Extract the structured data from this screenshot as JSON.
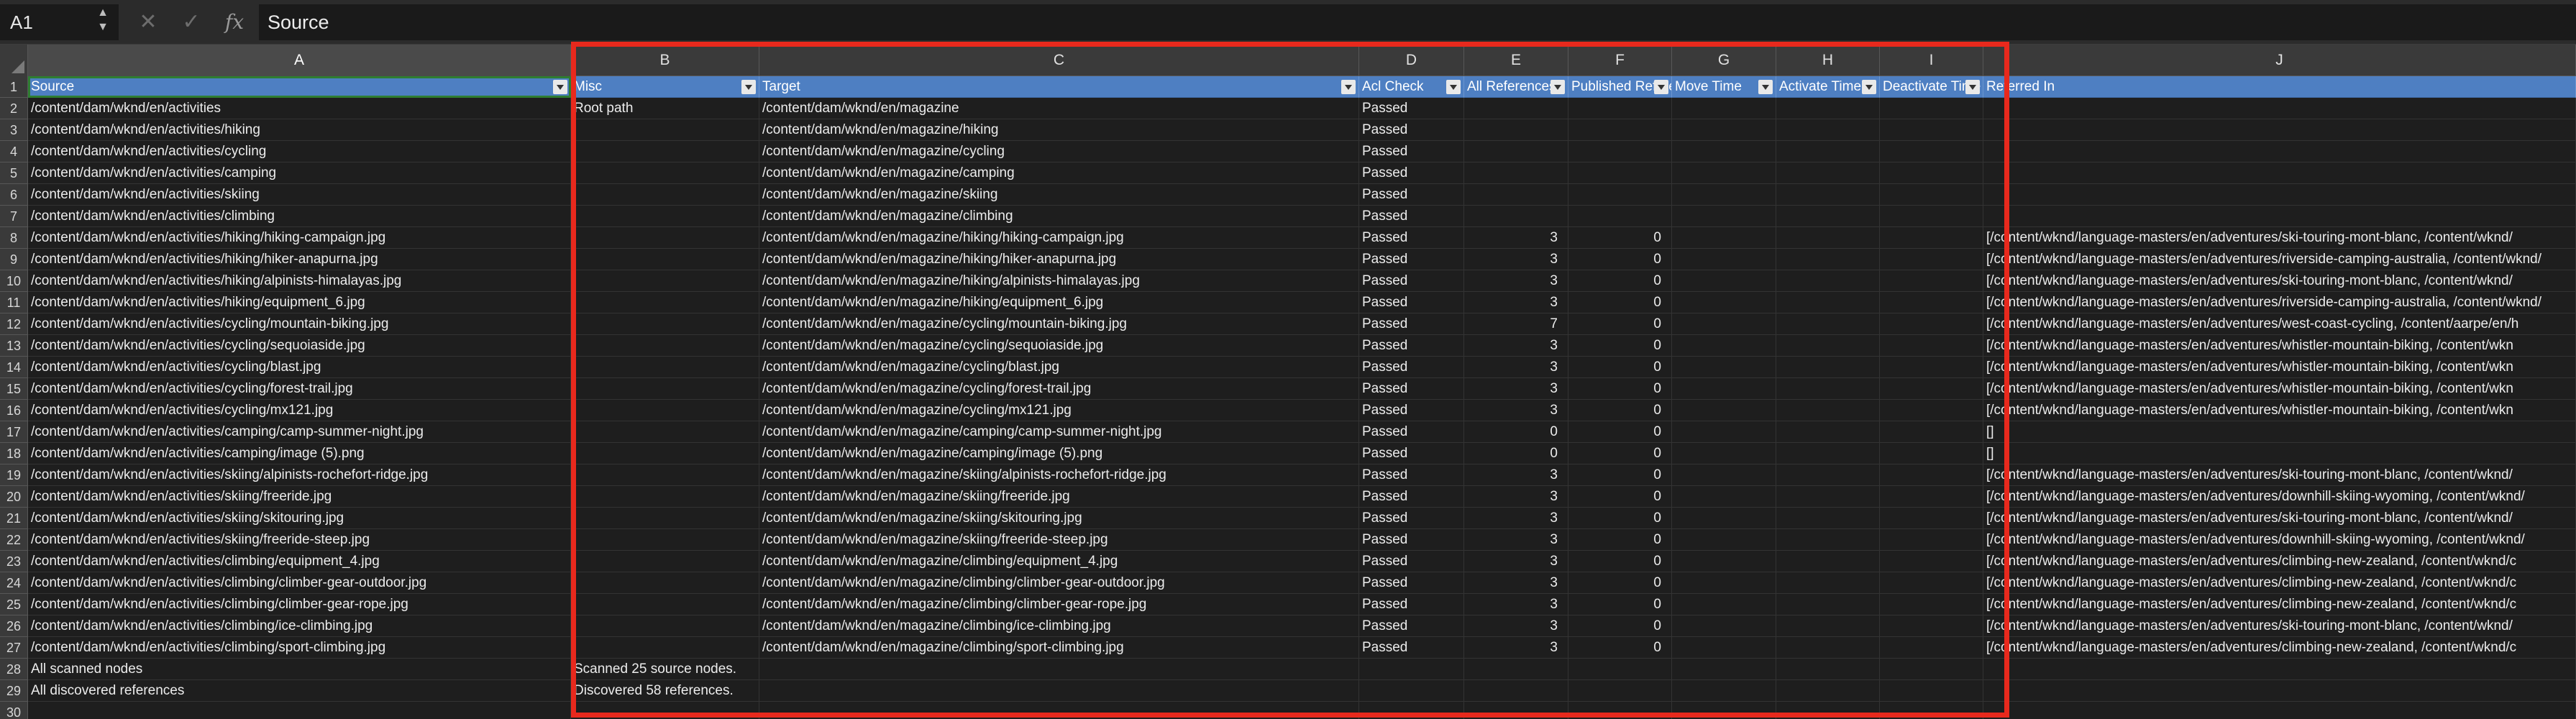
{
  "formula_bar": {
    "cell_ref": "A1",
    "cancel_icon": "✕",
    "enter_icon": "✓",
    "fx_label": "fx",
    "formula_value": "Source"
  },
  "columns": [
    "A",
    "B",
    "C",
    "D",
    "E",
    "F",
    "G",
    "H",
    "I",
    "J"
  ],
  "headers": [
    "Source",
    "Misc",
    "Target",
    "Acl Check",
    "All References",
    "Published References",
    "Move Time",
    "Activate Time",
    "Deactivate Time",
    "Referred In"
  ],
  "rows": [
    {
      "source": "/content/dam/wknd/en/activities",
      "misc": "Root path",
      "target": "/content/dam/wknd/en/magazine",
      "acl": "Passed",
      "all_refs": "",
      "pub_refs": "",
      "move": "",
      "activate": "",
      "deactivate": "",
      "referred": ""
    },
    {
      "source": "/content/dam/wknd/en/activities/hiking",
      "misc": "",
      "target": "/content/dam/wknd/en/magazine/hiking",
      "acl": "Passed",
      "all_refs": "",
      "pub_refs": "",
      "move": "",
      "activate": "",
      "deactivate": "",
      "referred": ""
    },
    {
      "source": "/content/dam/wknd/en/activities/cycling",
      "misc": "",
      "target": "/content/dam/wknd/en/magazine/cycling",
      "acl": "Passed",
      "all_refs": "",
      "pub_refs": "",
      "move": "",
      "activate": "",
      "deactivate": "",
      "referred": ""
    },
    {
      "source": "/content/dam/wknd/en/activities/camping",
      "misc": "",
      "target": "/content/dam/wknd/en/magazine/camping",
      "acl": "Passed",
      "all_refs": "",
      "pub_refs": "",
      "move": "",
      "activate": "",
      "deactivate": "",
      "referred": ""
    },
    {
      "source": "/content/dam/wknd/en/activities/skiing",
      "misc": "",
      "target": "/content/dam/wknd/en/magazine/skiing",
      "acl": "Passed",
      "all_refs": "",
      "pub_refs": "",
      "move": "",
      "activate": "",
      "deactivate": "",
      "referred": ""
    },
    {
      "source": "/content/dam/wknd/en/activities/climbing",
      "misc": "",
      "target": "/content/dam/wknd/en/magazine/climbing",
      "acl": "Passed",
      "all_refs": "",
      "pub_refs": "",
      "move": "",
      "activate": "",
      "deactivate": "",
      "referred": ""
    },
    {
      "source": "/content/dam/wknd/en/activities/hiking/hiking-campaign.jpg",
      "misc": "",
      "target": "/content/dam/wknd/en/magazine/hiking/hiking-campaign.jpg",
      "acl": "Passed",
      "all_refs": "3",
      "pub_refs": "0",
      "move": "",
      "activate": "",
      "deactivate": "",
      "referred": "[/content/wknd/language-masters/en/adventures/ski-touring-mont-blanc, /content/wknd/"
    },
    {
      "source": "/content/dam/wknd/en/activities/hiking/hiker-anapurna.jpg",
      "misc": "",
      "target": "/content/dam/wknd/en/magazine/hiking/hiker-anapurna.jpg",
      "acl": "Passed",
      "all_refs": "3",
      "pub_refs": "0",
      "move": "",
      "activate": "",
      "deactivate": "",
      "referred": "[/content/wknd/language-masters/en/adventures/riverside-camping-australia, /content/wknd/"
    },
    {
      "source": "/content/dam/wknd/en/activities/hiking/alpinists-himalayas.jpg",
      "misc": "",
      "target": "/content/dam/wknd/en/magazine/hiking/alpinists-himalayas.jpg",
      "acl": "Passed",
      "all_refs": "3",
      "pub_refs": "0",
      "move": "",
      "activate": "",
      "deactivate": "",
      "referred": "[/content/wknd/language-masters/en/adventures/ski-touring-mont-blanc, /content/wknd/"
    },
    {
      "source": "/content/dam/wknd/en/activities/hiking/equipment_6.jpg",
      "misc": "",
      "target": "/content/dam/wknd/en/magazine/hiking/equipment_6.jpg",
      "acl": "Passed",
      "all_refs": "3",
      "pub_refs": "0",
      "move": "",
      "activate": "",
      "deactivate": "",
      "referred": "[/content/wknd/language-masters/en/adventures/riverside-camping-australia, /content/wknd/"
    },
    {
      "source": "/content/dam/wknd/en/activities/cycling/mountain-biking.jpg",
      "misc": "",
      "target": "/content/dam/wknd/en/magazine/cycling/mountain-biking.jpg",
      "acl": "Passed",
      "all_refs": "7",
      "pub_refs": "0",
      "move": "",
      "activate": "",
      "deactivate": "",
      "referred": "[/content/wknd/language-masters/en/adventures/west-coast-cycling, /content/aarpe/en/h"
    },
    {
      "source": "/content/dam/wknd/en/activities/cycling/sequoiaside.jpg",
      "misc": "",
      "target": "/content/dam/wknd/en/magazine/cycling/sequoiaside.jpg",
      "acl": "Passed",
      "all_refs": "3",
      "pub_refs": "0",
      "move": "",
      "activate": "",
      "deactivate": "",
      "referred": "[/content/wknd/language-masters/en/adventures/whistler-mountain-biking, /content/wkn"
    },
    {
      "source": "/content/dam/wknd/en/activities/cycling/blast.jpg",
      "misc": "",
      "target": "/content/dam/wknd/en/magazine/cycling/blast.jpg",
      "acl": "Passed",
      "all_refs": "3",
      "pub_refs": "0",
      "move": "",
      "activate": "",
      "deactivate": "",
      "referred": "[/content/wknd/language-masters/en/adventures/whistler-mountain-biking, /content/wkn"
    },
    {
      "source": "/content/dam/wknd/en/activities/cycling/forest-trail.jpg",
      "misc": "",
      "target": "/content/dam/wknd/en/magazine/cycling/forest-trail.jpg",
      "acl": "Passed",
      "all_refs": "3",
      "pub_refs": "0",
      "move": "",
      "activate": "",
      "deactivate": "",
      "referred": "[/content/wknd/language-masters/en/adventures/whistler-mountain-biking, /content/wkn"
    },
    {
      "source": "/content/dam/wknd/en/activities/cycling/mx121.jpg",
      "misc": "",
      "target": "/content/dam/wknd/en/magazine/cycling/mx121.jpg",
      "acl": "Passed",
      "all_refs": "3",
      "pub_refs": "0",
      "move": "",
      "activate": "",
      "deactivate": "",
      "referred": "[/content/wknd/language-masters/en/adventures/whistler-mountain-biking, /content/wkn"
    },
    {
      "source": "/content/dam/wknd/en/activities/camping/camp-summer-night.jpg",
      "misc": "",
      "target": "/content/dam/wknd/en/magazine/camping/camp-summer-night.jpg",
      "acl": "Passed",
      "all_refs": "0",
      "pub_refs": "0",
      "move": "",
      "activate": "",
      "deactivate": "",
      "referred": "[]"
    },
    {
      "source": "/content/dam/wknd/en/activities/camping/image (5).png",
      "misc": "",
      "target": "/content/dam/wknd/en/magazine/camping/image (5).png",
      "acl": "Passed",
      "all_refs": "0",
      "pub_refs": "0",
      "move": "",
      "activate": "",
      "deactivate": "",
      "referred": "[]"
    },
    {
      "source": "/content/dam/wknd/en/activities/skiing/alpinists-rochefort-ridge.jpg",
      "misc": "",
      "target": "/content/dam/wknd/en/magazine/skiing/alpinists-rochefort-ridge.jpg",
      "acl": "Passed",
      "all_refs": "3",
      "pub_refs": "0",
      "move": "",
      "activate": "",
      "deactivate": "",
      "referred": "[/content/wknd/language-masters/en/adventures/ski-touring-mont-blanc, /content/wknd/"
    },
    {
      "source": "/content/dam/wknd/en/activities/skiing/freeride.jpg",
      "misc": "",
      "target": "/content/dam/wknd/en/magazine/skiing/freeride.jpg",
      "acl": "Passed",
      "all_refs": "3",
      "pub_refs": "0",
      "move": "",
      "activate": "",
      "deactivate": "",
      "referred": "[/content/wknd/language-masters/en/adventures/downhill-skiing-wyoming, /content/wknd/"
    },
    {
      "source": "/content/dam/wknd/en/activities/skiing/skitouring.jpg",
      "misc": "",
      "target": "/content/dam/wknd/en/magazine/skiing/skitouring.jpg",
      "acl": "Passed",
      "all_refs": "3",
      "pub_refs": "0",
      "move": "",
      "activate": "",
      "deactivate": "",
      "referred": "[/content/wknd/language-masters/en/adventures/ski-touring-mont-blanc, /content/wknd/"
    },
    {
      "source": "/content/dam/wknd/en/activities/skiing/freeride-steep.jpg",
      "misc": "",
      "target": "/content/dam/wknd/en/magazine/skiing/freeride-steep.jpg",
      "acl": "Passed",
      "all_refs": "3",
      "pub_refs": "0",
      "move": "",
      "activate": "",
      "deactivate": "",
      "referred": "[/content/wknd/language-masters/en/adventures/downhill-skiing-wyoming, /content/wknd/"
    },
    {
      "source": "/content/dam/wknd/en/activities/climbing/equipment_4.jpg",
      "misc": "",
      "target": "/content/dam/wknd/en/magazine/climbing/equipment_4.jpg",
      "acl": "Passed",
      "all_refs": "3",
      "pub_refs": "0",
      "move": "",
      "activate": "",
      "deactivate": "",
      "referred": "[/content/wknd/language-masters/en/adventures/climbing-new-zealand, /content/wknd/c"
    },
    {
      "source": "/content/dam/wknd/en/activities/climbing/climber-gear-outdoor.jpg",
      "misc": "",
      "target": "/content/dam/wknd/en/magazine/climbing/climber-gear-outdoor.jpg",
      "acl": "Passed",
      "all_refs": "3",
      "pub_refs": "0",
      "move": "",
      "activate": "",
      "deactivate": "",
      "referred": "[/content/wknd/language-masters/en/adventures/climbing-new-zealand, /content/wknd/c"
    },
    {
      "source": "/content/dam/wknd/en/activities/climbing/climber-gear-rope.jpg",
      "misc": "",
      "target": "/content/dam/wknd/en/magazine/climbing/climber-gear-rope.jpg",
      "acl": "Passed",
      "all_refs": "3",
      "pub_refs": "0",
      "move": "",
      "activate": "",
      "deactivate": "",
      "referred": "[/content/wknd/language-masters/en/adventures/climbing-new-zealand, /content/wknd/c"
    },
    {
      "source": "/content/dam/wknd/en/activities/climbing/ice-climbing.jpg",
      "misc": "",
      "target": "/content/dam/wknd/en/magazine/climbing/ice-climbing.jpg",
      "acl": "Passed",
      "all_refs": "3",
      "pub_refs": "0",
      "move": "",
      "activate": "",
      "deactivate": "",
      "referred": "[/content/wknd/language-masters/en/adventures/ski-touring-mont-blanc, /content/wknd/"
    },
    {
      "source": "/content/dam/wknd/en/activities/climbing/sport-climbing.jpg",
      "misc": "",
      "target": "/content/dam/wknd/en/magazine/climbing/sport-climbing.jpg",
      "acl": "Passed",
      "all_refs": "3",
      "pub_refs": "0",
      "move": "",
      "activate": "",
      "deactivate": "",
      "referred": "[/content/wknd/language-masters/en/adventures/climbing-new-zealand, /content/wknd/c"
    },
    {
      "source": "All scanned nodes",
      "misc": "Scanned 25 source nodes.",
      "target": "",
      "acl": "",
      "all_refs": "",
      "pub_refs": "",
      "move": "",
      "activate": "",
      "deactivate": "",
      "referred": ""
    },
    {
      "source": "All discovered references",
      "misc": "Discovered 58 references.",
      "target": "",
      "acl": "",
      "all_refs": "",
      "pub_refs": "",
      "move": "",
      "activate": "",
      "deactivate": "",
      "referred": ""
    },
    {
      "source": "",
      "misc": "",
      "target": "",
      "acl": "",
      "all_refs": "",
      "pub_refs": "",
      "move": "",
      "activate": "",
      "deactivate": "",
      "referred": ""
    }
  ],
  "colors": {
    "header_fill": "#4e7fc2",
    "highlight_box": "#e8291d",
    "active_cell_border": "#2e7d32"
  }
}
